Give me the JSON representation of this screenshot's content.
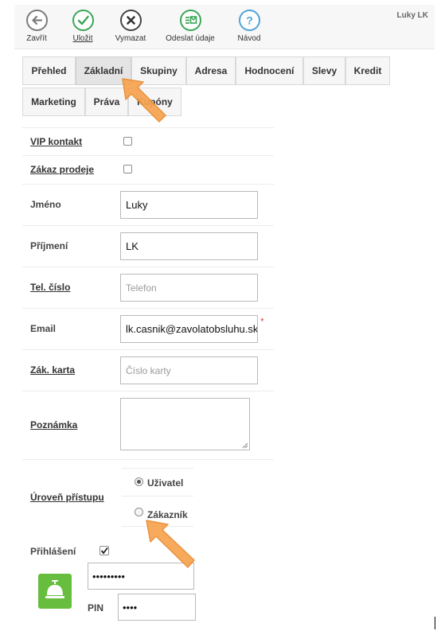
{
  "toolbar": {
    "close_label": "Zavřít",
    "save_label": "Uložit",
    "delete_label": "Vymazat",
    "send_label": "Odeslat údaje",
    "help_label": "Návod",
    "user_name": "Luky LK"
  },
  "tabs": [
    {
      "label": "Přehled",
      "active": false
    },
    {
      "label": "Základní",
      "active": true
    },
    {
      "label": "Skupiny",
      "active": false
    },
    {
      "label": "Adresa",
      "active": false
    },
    {
      "label": "Hodnocení",
      "active": false
    },
    {
      "label": "Slevy",
      "active": false
    },
    {
      "label": "Kredit",
      "active": false
    },
    {
      "label": "Marketing",
      "active": false
    },
    {
      "label": "Práva",
      "active": false
    },
    {
      "label": "Kupóny",
      "active": false
    }
  ],
  "form": {
    "vip": {
      "label": "VIP kontakt",
      "checked": false
    },
    "sale_ban": {
      "label": "Zákaz prodeje",
      "checked": false
    },
    "first_name": {
      "label": "Jméno",
      "value": "Luky"
    },
    "last_name": {
      "label": "Příjmení",
      "value": "LK"
    },
    "phone": {
      "label": "Tel. číslo",
      "placeholder": "Telefon"
    },
    "email": {
      "label": "Email",
      "value": "lk.casnik@zavolatobsluhu.sk",
      "required_mark": "*"
    },
    "card": {
      "label": "Zák. karta",
      "placeholder": "Číslo karty"
    },
    "note": {
      "label": "Poznámka"
    },
    "access": {
      "label": "Úroveň přístupu",
      "options": [
        {
          "label": "Uživatel",
          "selected": true
        },
        {
          "label": "Zákazník",
          "selected": false
        }
      ]
    },
    "login": {
      "label": "Přihlášení",
      "checked": true,
      "password_mask": "•••••••••"
    },
    "pin": {
      "label": "PIN",
      "mask": "••••"
    }
  },
  "colors": {
    "save_green": "#3aa655",
    "send_green": "#3aa655",
    "help_blue": "#4da3d8",
    "bell_green": "#67be3e",
    "arrow_orange": "#f7a24f"
  },
  "icons": [
    "back-arrow-icon",
    "check-icon",
    "close-x-icon",
    "send-data-icon",
    "question-icon",
    "service-bell-icon",
    "pointer-arrow-icon"
  ]
}
